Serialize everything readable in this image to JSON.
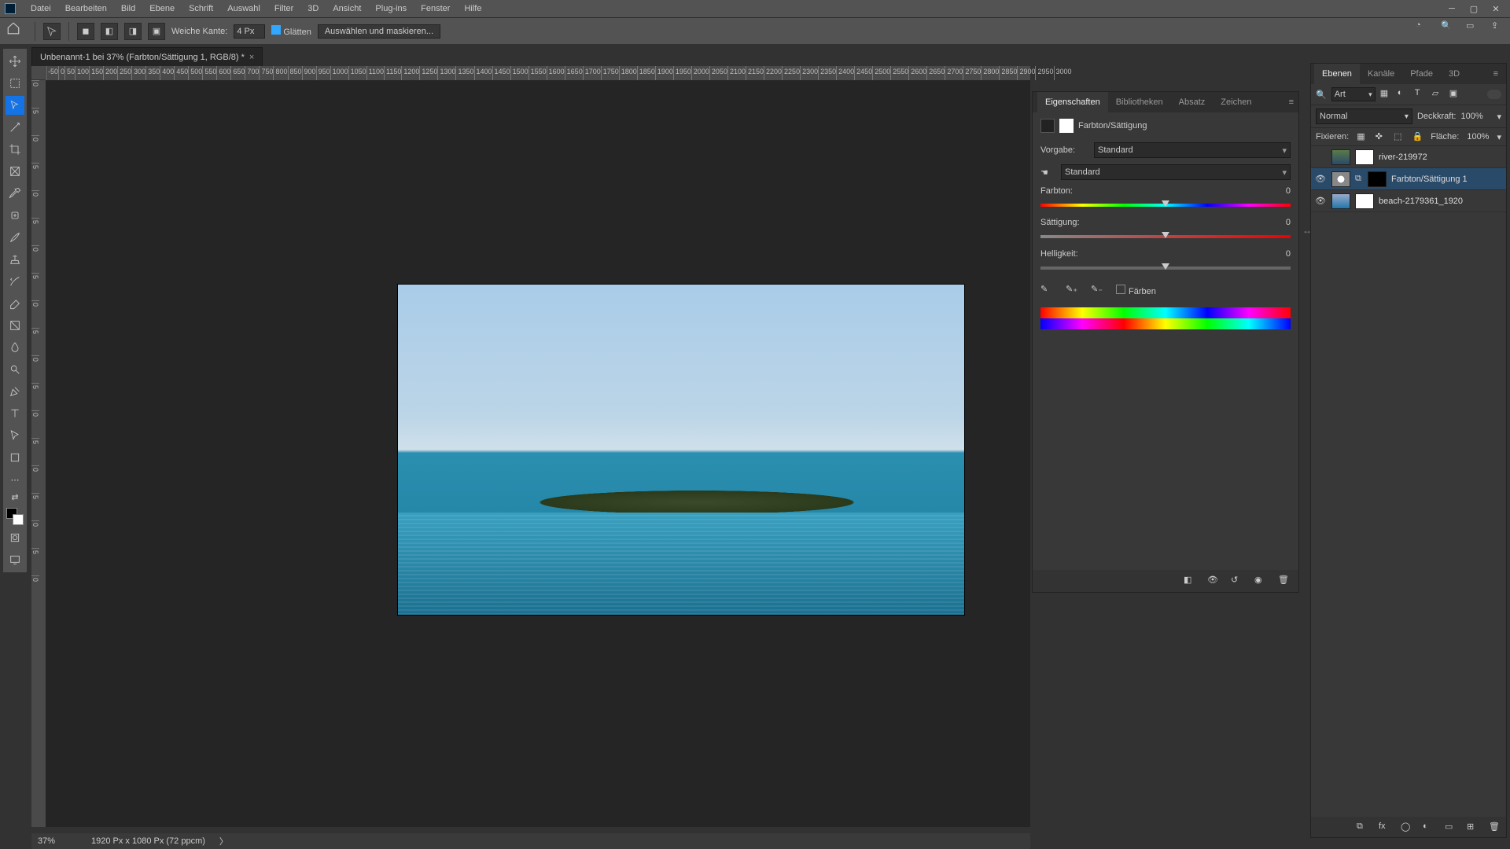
{
  "menu": [
    "Datei",
    "Bearbeiten",
    "Bild",
    "Ebene",
    "Schrift",
    "Auswahl",
    "Filter",
    "3D",
    "Ansicht",
    "Plug-ins",
    "Fenster",
    "Hilfe"
  ],
  "optbar": {
    "feather_label": "Weiche Kante:",
    "feather_value": "4 Px",
    "antialias": "Glätten",
    "select_mask": "Auswählen und maskieren..."
  },
  "doctab": {
    "title": "Unbenannt-1 bei 37% (Farbton/Sättigung 1, RGB/8) *"
  },
  "ruler_h": [
    "-50",
    "0",
    "50",
    "100",
    "150",
    "200",
    "250",
    "300",
    "350",
    "400",
    "450",
    "500",
    "550",
    "600",
    "650",
    "700",
    "750",
    "800",
    "850",
    "900",
    "950",
    "1000",
    "1050",
    "1100",
    "1150",
    "1200",
    "1250",
    "1300",
    "1350",
    "1400",
    "1450",
    "1500",
    "1550",
    "1600",
    "1650",
    "1700",
    "1750",
    "1800",
    "1850",
    "1900",
    "1950",
    "2000",
    "2050",
    "2100",
    "2150",
    "2200",
    "2250",
    "2300",
    "2350",
    "2400",
    "2450",
    "2500",
    "2550",
    "2600",
    "2650",
    "2700",
    "2750",
    "2800",
    "2850",
    "2900",
    "2950",
    "3000"
  ],
  "ruler_v": [
    "0",
    "5",
    "0",
    "5",
    "0",
    "5",
    "0",
    "5",
    "0",
    "5",
    "0",
    "5",
    "0",
    "5",
    "0",
    "5",
    "0",
    "5",
    "0"
  ],
  "status": {
    "zoom": "37%",
    "info": "1920 Px x 1080 Px (72 ppcm)"
  },
  "props": {
    "tabs": [
      "Eigenschaften",
      "Bibliotheken",
      "Absatz",
      "Zeichen"
    ],
    "adj_name": "Farbton/Sättigung",
    "preset_label": "Vorgabe:",
    "preset_value": "Standard",
    "channel_value": "Standard",
    "hue_label": "Farbton:",
    "hue_value": "0",
    "sat_label": "Sättigung:",
    "sat_value": "0",
    "light_label": "Helligkeit:",
    "light_value": "0",
    "colorize": "Färben"
  },
  "layers": {
    "tabs": [
      "Ebenen",
      "Kanäle",
      "Pfade",
      "3D"
    ],
    "filter_kind": "Art",
    "blend": "Normal",
    "opacity_label": "Deckkraft:",
    "opacity_value": "100%",
    "lock_label": "Fixieren:",
    "fill_label": "Fläche:",
    "fill_value": "100%",
    "rows": [
      {
        "visible": false,
        "name": "river-219972",
        "type": "image"
      },
      {
        "visible": true,
        "name": "Farbton/Sättigung 1",
        "type": "adjustment",
        "selected": true
      },
      {
        "visible": true,
        "name": "beach-2179361_1920",
        "type": "image"
      }
    ]
  },
  "chart_data": null
}
